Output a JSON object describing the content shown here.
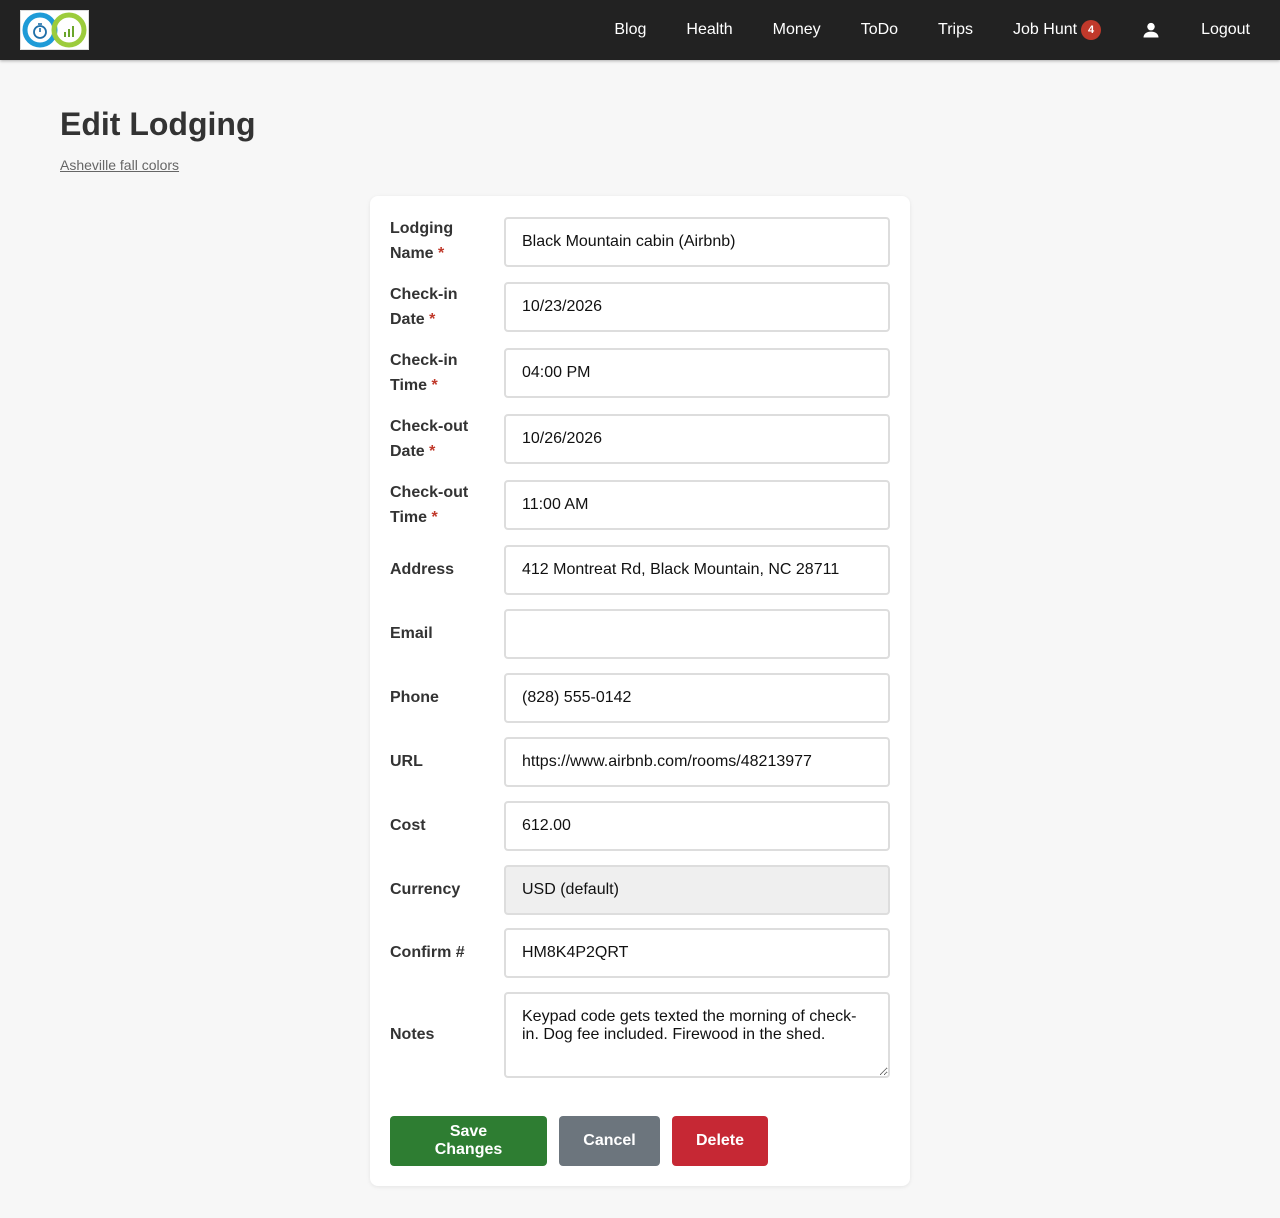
{
  "nav": {
    "items": [
      "Blog",
      "Health",
      "Money",
      "ToDo",
      "Trips",
      "Job Hunt"
    ],
    "job_hunt_badge": "4",
    "logout": "Logout"
  },
  "page": {
    "title": "Edit Lodging",
    "breadcrumb": "Asheville fall colors"
  },
  "form": {
    "lodging_name": {
      "label_1": "Lodging",
      "label_2": "Name",
      "value": "Black Mountain cabin (Airbnb)"
    },
    "checkin_date": {
      "label_1": "Check-in",
      "label_2": "Date",
      "value": "10/23/2026"
    },
    "checkin_time": {
      "label_1": "Check-in",
      "label_2": "Time",
      "value": "04:00 PM"
    },
    "checkout_date": {
      "label_1": "Check-out",
      "label_2": "Date",
      "value": "10/26/2026"
    },
    "checkout_time": {
      "label_1": "Check-out",
      "label_2": "Time",
      "value": "11:00 AM"
    },
    "address": {
      "label": "Address",
      "value": "412 Montreat Rd, Black Mountain, NC 28711"
    },
    "email": {
      "label": "Email",
      "value": ""
    },
    "phone": {
      "label": "Phone",
      "value": "(828) 555-0142"
    },
    "url": {
      "label": "URL",
      "value": "https://www.airbnb.com/rooms/48213977"
    },
    "cost": {
      "label": "Cost",
      "value": "612.00"
    },
    "currency": {
      "label": "Currency",
      "value": "USD (default)"
    },
    "confirm": {
      "label": "Confirm #",
      "value": "HM8K4P2QRT"
    },
    "notes": {
      "label": "Notes",
      "value": "Keypad code gets texted the morning of check-in. Dog fee included. Firewood in the shed."
    },
    "required_mark": "*"
  },
  "buttons": {
    "save": "Save Changes",
    "cancel": "Cancel",
    "delete": "Delete"
  },
  "colors": {
    "nav_bg": "#222222",
    "save": "#2e7d32",
    "cancel": "#6c757d",
    "delete": "#c62834",
    "badge": "#c0392b"
  }
}
